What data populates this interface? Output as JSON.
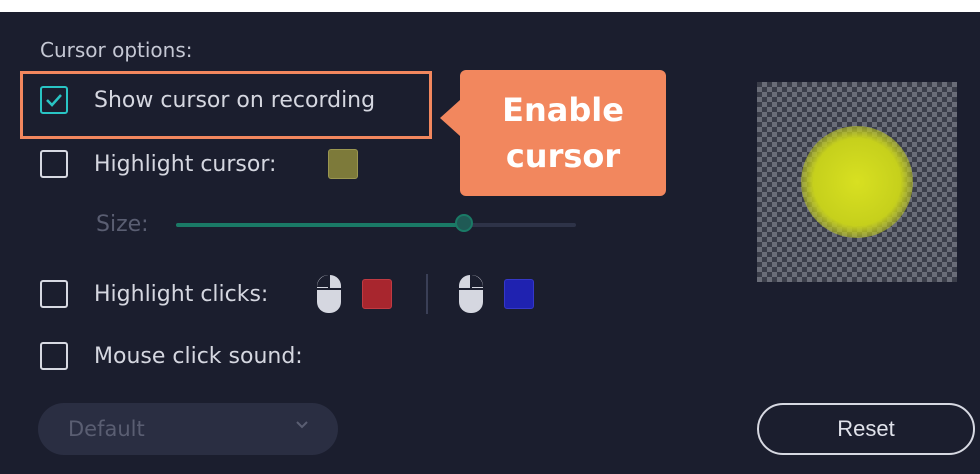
{
  "section_title": "Cursor options:",
  "options": {
    "show_cursor": {
      "label": "Show cursor on recording",
      "checked": true
    },
    "highlight_cursor": {
      "label": "Highlight cursor:",
      "checked": false,
      "color": "#7d7a3a"
    },
    "size": {
      "label": "Size:",
      "value": 0.72
    },
    "highlight_clicks": {
      "label": "Highlight clicks:",
      "checked": false,
      "left_click_color": "#a8262e",
      "right_click_color": "#1f22b0"
    },
    "click_sound": {
      "label": "Mouse click sound:",
      "checked": false
    }
  },
  "callout": {
    "line1": "Enable",
    "line2": "cursor",
    "color": "#f2875e"
  },
  "sound_dropdown": {
    "value": "Default"
  },
  "reset_label": "Reset",
  "colors": {
    "panel_bg": "#1b1e2e",
    "accent": "#29c4c4",
    "slider_fill": "#1a7a66"
  }
}
